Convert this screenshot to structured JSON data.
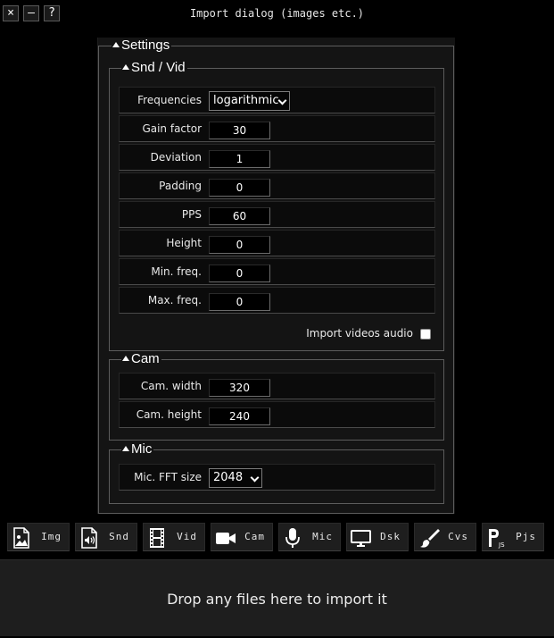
{
  "window": {
    "title": "Import dialog (images etc.)",
    "close_label": "×",
    "minimize_label": "–",
    "help_label": "?"
  },
  "settings": {
    "title": "Settings",
    "snd_vid": {
      "title": "Snd / Vid",
      "frequencies": {
        "label": "Frequencies",
        "value": "logarithmic"
      },
      "gain_factor": {
        "label": "Gain factor",
        "value": "30"
      },
      "deviation": {
        "label": "Deviation",
        "value": "1"
      },
      "padding": {
        "label": "Padding",
        "value": "0"
      },
      "pps": {
        "label": "PPS",
        "value": "60"
      },
      "height": {
        "label": "Height",
        "value": "0"
      },
      "min_freq": {
        "label": "Min. freq.",
        "value": "0"
      },
      "max_freq": {
        "label": "Max. freq.",
        "value": "0"
      },
      "import_videos_audio": {
        "label": "Import videos audio",
        "checked": false
      }
    },
    "cam": {
      "title": "Cam",
      "width": {
        "label": "Cam. width",
        "value": "320"
      },
      "height": {
        "label": "Cam. height",
        "value": "240"
      }
    },
    "mic": {
      "title": "Mic",
      "fft_size": {
        "label": "Mic. FFT size",
        "value": "2048"
      }
    }
  },
  "sources": [
    {
      "label": "Img",
      "icon": "image-icon"
    },
    {
      "label": "Snd",
      "icon": "sound-file-icon"
    },
    {
      "label": "Vid",
      "icon": "film-icon"
    },
    {
      "label": "Cam",
      "icon": "camera-icon"
    },
    {
      "label": "Mic",
      "icon": "microphone-icon"
    },
    {
      "label": "Dsk",
      "icon": "monitor-icon"
    },
    {
      "label": "Cvs",
      "icon": "paintbrush-icon"
    },
    {
      "label": "Pjs",
      "icon": "processing-js-icon"
    }
  ],
  "dropzone": {
    "text": "Drop any files here to import it"
  },
  "colors": {
    "background": "#000000",
    "panel": "#141414",
    "row": "#0b0b0b",
    "border": "#5c5c5c",
    "button": "#1e1e1e"
  }
}
